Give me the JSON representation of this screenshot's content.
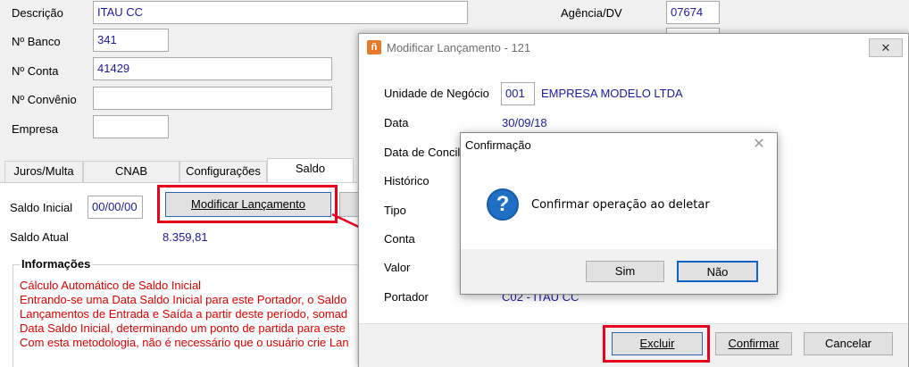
{
  "form": {
    "descricao_label": "Descrição",
    "descricao_value": "ITAU CC",
    "banco_label": "Nº Banco",
    "banco_value": "341",
    "conta_label": "Nº Conta",
    "conta_value": "41429",
    "convenio_label": "Nº Convênio",
    "convenio_value": "",
    "empresa_label": "Empresa",
    "empresa_value": "",
    "agencia_label": "Agência/DV",
    "agencia_value": "07674"
  },
  "tabs": [
    {
      "label": "Juros/Multa"
    },
    {
      "label": "CNAB"
    },
    {
      "label": "Configurações"
    },
    {
      "label": "Saldo"
    }
  ],
  "saldo": {
    "inicial_label": "Saldo Inicial",
    "inicial_value": "00/00/00",
    "modificar_button": "Modificar Lançamento",
    "atual_label": "Saldo Atual",
    "atual_value": "8.359,81"
  },
  "info": {
    "title": "Informações",
    "lines": [
      "Cálculo Automático de Saldo Inicial",
      "Entrando-se uma Data Saldo Inicial para este Portador, o Saldo",
      "Lançamentos de Entrada e Saída a partir deste período, somad",
      "Data Saldo Inicial, determinando um ponto de partida para este",
      "Com esta metodologia, não é necessário que o usuário crie Lan"
    ]
  },
  "modal": {
    "title": "Modificar Lançamento - 121",
    "unidade_label": "Unidade de Negócio",
    "unidade_code": "001",
    "unidade_name": "EMPRESA MODELO LTDA",
    "data_label": "Data",
    "data_value": "30/09/18",
    "data_conc_label": "Data de Concil",
    "historico_label": "Histórico",
    "tipo_label": "Tipo",
    "conta_label": "Conta",
    "valor_label": "Valor",
    "portador_label": "Portador",
    "portador_value": "C02  -  ITAU CC",
    "excluir_button": "Excluir",
    "confirmar_button": "Confirmar",
    "cancelar_button": "Cancelar"
  },
  "confirm": {
    "title": "Confirmação",
    "message": "Confirmar operação ao deletar",
    "sim_button": "Sim",
    "nao_button": "Não"
  },
  "colors": {
    "highlight": "#e8001c",
    "info_text": "#e00000",
    "value_text": "#1a1aa0",
    "question_icon": "#1f6fc5"
  }
}
